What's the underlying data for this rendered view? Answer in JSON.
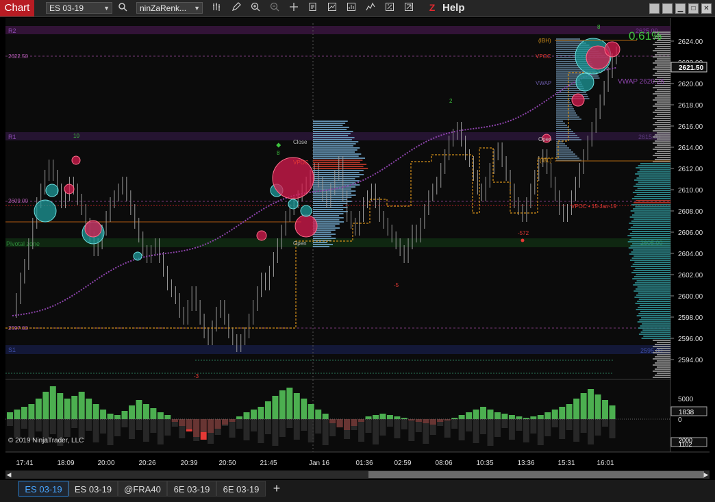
{
  "app": {
    "title": "Chart",
    "help_label": "Help"
  },
  "toolbar": {
    "instrument": "ES 03-19",
    "bar_type": "ninZaRenk...",
    "icons": [
      "search-icon",
      "bar-style-icon",
      "draw-pencil-icon",
      "zoom-in-icon",
      "zoom-out-icon",
      "crosshair-icon",
      "data-box-icon",
      "indicators-icon",
      "strategies-icon",
      "templates-icon",
      "properties-icon",
      "share-icon",
      "ninza-logo-icon"
    ]
  },
  "window_controls": [
    "restore-button",
    "minimize-button",
    "maximize-button",
    "close-button"
  ],
  "price_axis": {
    "ticks": [
      "2624.00",
      "2622.00",
      "2620.00",
      "2618.00",
      "2616.00",
      "2614.00",
      "2612.00",
      "2610.00",
      "2608.00",
      "2606.00",
      "2604.00",
      "2602.00",
      "2600.00",
      "2598.00",
      "2596.00",
      "2594.00"
    ],
    "last_price": "2621.50",
    "percent_change": "0.61%"
  },
  "time_axis": [
    "17:41",
    "18:09",
    "20:00",
    "20:26",
    "20:39",
    "20:50",
    "21:45",
    "Jan 16",
    "01:36",
    "02:59",
    "08:06",
    "10:35",
    "13:36",
    "15:31",
    "16:01"
  ],
  "levels": {
    "r2": "R2",
    "r1": "R1",
    "s1": "S1",
    "pivotal_zone": "Pivotal zone",
    "left_price_labels": [
      "2622.50",
      "2609.00",
      "2597.00"
    ],
    "r2_value": "2625.00",
    "r1_value": "2615.00",
    "pivot_value": "2605.00",
    "s1_value": "2595.00",
    "vwap_label": "VWAP 2620.25",
    "vpoc_prev_label": "VPOC • 15-Jan-19",
    "profile_labels": [
      "Close",
      "VPOC",
      "Open",
      "VWAP",
      "VPOC",
      "(IBH)",
      "(IBL)",
      "Open"
    ],
    "swing_labels": [
      "10",
      "8",
      "2",
      "8",
      "-3",
      "-5",
      "-572"
    ]
  },
  "indicator": {
    "ticks": [
      "5000",
      "0"
    ],
    "value": "1838",
    "volume_box": "1102",
    "volume_box2": "2000"
  },
  "copyright": "© 2019 NinjaTrader, LLC",
  "tabs": [
    {
      "label": "ES 03-19",
      "active": true
    },
    {
      "label": "ES 03-19",
      "active": false
    },
    {
      "label": "@FRA40",
      "active": false
    },
    {
      "label": "6E 03-19",
      "active": false
    },
    {
      "label": "6E 03-19",
      "active": false
    }
  ],
  "add_tab": "+",
  "colors": {
    "accent": "#b81c23",
    "bull": "#4caf50",
    "bear": "#e53935",
    "profile": "#2f8f93",
    "vwap": "#8e44ad"
  }
}
